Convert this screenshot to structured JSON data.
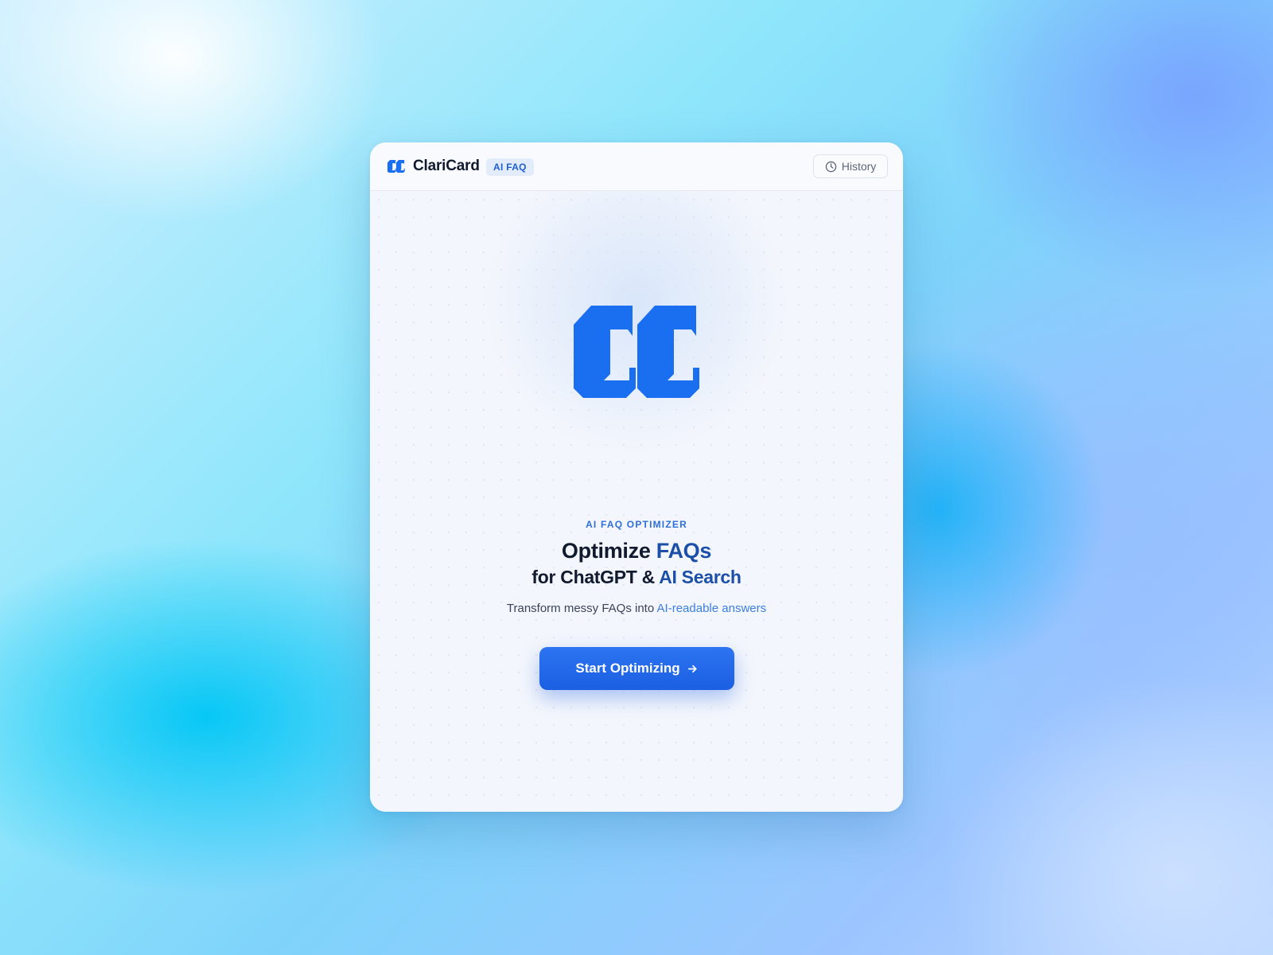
{
  "header": {
    "brand_name": "ClariCard",
    "badge": "AI FAQ",
    "history_label": "History"
  },
  "hero": {
    "eyebrow": "AI FAQ OPTIMIZER",
    "headline_line1_a": "Optimize ",
    "headline_line1_b": "FAQs",
    "headline_line2_a": "for ChatGPT & ",
    "headline_line2_b": "AI Search",
    "subtext_a": "Transform messy FAQs into ",
    "subtext_b": "AI-readable answers",
    "cta_label": "Start Optimizing"
  },
  "icons": {
    "brand_logo": "cc-logo-icon",
    "history": "clock-icon",
    "cta_arrow": "arrow-right-icon"
  },
  "colors": {
    "brand_blue": "#1a6ff0",
    "accent_text": "#1c4fa8",
    "link_blue": "#3c7ee0",
    "cta_blue": "#1b5fe2",
    "heading": "#111a2e"
  }
}
